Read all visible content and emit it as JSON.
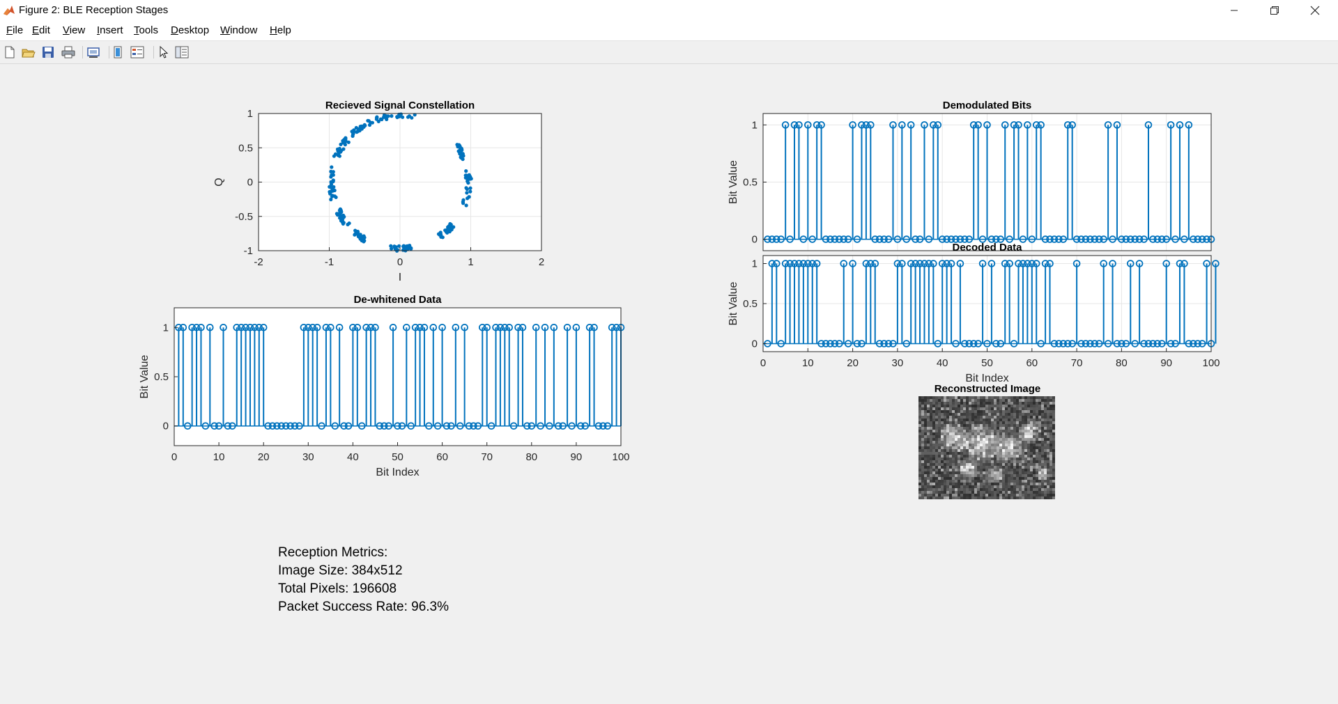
{
  "window": {
    "title": "Figure 2: BLE Reception Stages",
    "app_icon": "matlab-icon",
    "controls": [
      "minimize-icon",
      "maximize-icon",
      "close-icon"
    ]
  },
  "menu": {
    "file": {
      "label": "File",
      "underline": "F",
      "rest": "ile"
    },
    "edit": {
      "label": "Edit",
      "underline": "E",
      "rest": "dit"
    },
    "view": {
      "label": "View",
      "underline": "V",
      "rest": "iew"
    },
    "insert": {
      "label": "Insert",
      "underline": "I",
      "rest": "nsert"
    },
    "tools": {
      "label": "Tools",
      "underline": "T",
      "rest": "ools"
    },
    "desktop": {
      "label": "Desktop",
      "underline": "D",
      "rest": "esktop"
    },
    "window": {
      "label": "Window",
      "underline": "W",
      "rest": "indow"
    },
    "help": {
      "label": "Help",
      "underline": "H",
      "rest": "elp"
    }
  },
  "toolbar": {
    "icons": [
      "new-figure-icon",
      "open-file-icon",
      "save-icon",
      "print-icon",
      "print-preview-icon",
      "colorbar-icon",
      "legend-icon",
      "pointer-icon",
      "property-inspector-icon"
    ]
  },
  "colors": {
    "series": "#0072bd",
    "grid": "#e6e6e6",
    "axes": "#262626"
  },
  "chart_data": [
    {
      "id": "constellation",
      "type": "scatter",
      "title": "Recieved Signal Constellation",
      "xlabel": "I",
      "ylabel": "Q",
      "xlim": [
        -2,
        2
      ],
      "ylim": [
        -1,
        1
      ],
      "xticks": [
        -2,
        -1,
        0,
        1,
        2
      ],
      "yticks": [
        -1,
        -0.5,
        0,
        0.5,
        1
      ],
      "xticklabels": [
        "-2",
        "-1",
        "0",
        "1",
        "2"
      ],
      "yticklabels": [
        "-1",
        "-0.5",
        "0",
        "0.5",
        "1"
      ],
      "grid": true,
      "clusters": [
        {
          "angle_start": 78,
          "angle_end": 112
        },
        {
          "angle_start": 114,
          "angle_end": 135
        },
        {
          "angle_start": 140,
          "angle_end": 158
        },
        {
          "angle_start": 165,
          "angle_end": 195
        },
        {
          "angle_start": 205,
          "angle_end": 220
        },
        {
          "angle_start": 225,
          "angle_end": 240
        },
        {
          "angle_start": 262,
          "angle_end": 280
        },
        {
          "angle_start": 305,
          "angle_end": 320
        },
        {
          "angle_start": 340,
          "angle_end": 370
        },
        {
          "angle_start": 20,
          "angle_end": 35
        }
      ]
    },
    {
      "id": "demodulated",
      "type": "stem",
      "title": "Demodulated Bits",
      "xlabel": "",
      "ylabel": "Bit Value",
      "xlim": [
        0,
        100
      ],
      "ylim": [
        -0.1,
        1.1
      ],
      "xticks": [],
      "yticks": [
        0,
        0.5,
        1
      ],
      "yticklabels": [
        "0",
        "0.5",
        "1"
      ],
      "grid": true,
      "values": [
        0,
        0,
        0,
        0,
        1,
        0,
        1,
        1,
        0,
        1,
        0,
        1,
        1,
        0,
        0,
        0,
        0,
        0,
        0,
        1,
        0,
        1,
        1,
        1,
        0,
        0,
        0,
        0,
        1,
        0,
        1,
        0,
        1,
        0,
        0,
        1,
        0,
        1,
        1,
        0,
        0,
        0,
        0,
        0,
        0,
        0,
        1,
        1,
        0,
        1,
        0,
        0,
        0,
        1,
        0,
        1,
        1,
        0,
        1,
        0,
        1,
        1,
        0,
        0,
        0,
        0,
        0,
        1,
        1,
        0,
        0,
        0,
        0,
        0,
        0,
        0,
        1,
        0,
        1,
        0,
        0,
        0,
        0,
        0,
        0,
        1,
        0,
        0,
        0,
        0,
        1,
        0,
        1,
        0,
        1,
        0,
        0,
        0,
        0,
        0
      ]
    },
    {
      "id": "decoded",
      "type": "stem",
      "title": "Decoded Data",
      "xlabel": "Bit Index",
      "ylabel": "Bit Value",
      "xlim": [
        0,
        100
      ],
      "ylim": [
        -0.1,
        1.1
      ],
      "xticks": [
        0,
        10,
        20,
        30,
        40,
        50,
        60,
        70,
        80,
        90,
        100
      ],
      "xticklabels": [
        "0",
        "10",
        "20",
        "30",
        "40",
        "50",
        "60",
        "70",
        "80",
        "90",
        "100"
      ],
      "yticks": [
        0,
        0.5,
        1
      ],
      "yticklabels": [
        "0",
        "0.5",
        "1"
      ],
      "grid": true,
      "values": [
        0,
        1,
        1,
        0,
        1,
        1,
        1,
        1,
        1,
        1,
        1,
        1,
        0,
        0,
        0,
        0,
        0,
        1,
        0,
        1,
        0,
        0,
        1,
        1,
        1,
        0,
        0,
        0,
        0,
        1,
        1,
        0,
        1,
        1,
        1,
        1,
        1,
        1,
        0,
        1,
        1,
        1,
        0,
        1,
        0,
        0,
        0,
        0,
        1,
        0,
        1,
        0,
        0,
        1,
        1,
        0,
        1,
        1,
        1,
        1,
        1,
        0,
        1,
        1,
        0,
        0,
        0,
        0,
        0,
        1,
        0,
        0,
        0,
        0,
        0,
        1,
        0,
        1,
        0,
        0,
        0,
        1,
        0,
        1,
        0,
        0,
        0,
        0,
        0,
        1,
        0,
        0,
        1,
        1,
        0,
        0,
        0,
        0,
        1,
        0,
        1
      ]
    },
    {
      "id": "dewhitened",
      "type": "stem",
      "title": "De-whitened Data",
      "xlabel": "Bit Index",
      "ylabel": "Bit Value",
      "xlim": [
        0,
        100
      ],
      "ylim": [
        -0.2,
        1.2
      ],
      "xticks": [
        0,
        10,
        20,
        30,
        40,
        50,
        60,
        70,
        80,
        90,
        100
      ],
      "xticklabels": [
        "0",
        "10",
        "20",
        "30",
        "40",
        "50",
        "60",
        "70",
        "80",
        "90",
        "100"
      ],
      "yticks": [
        0,
        0.5,
        1
      ],
      "yticklabels": [
        "0",
        "0.5",
        "1"
      ],
      "grid": false,
      "values": [
        1,
        1,
        0,
        1,
        1,
        1,
        0,
        1,
        0,
        0,
        1,
        0,
        0,
        1,
        1,
        1,
        1,
        1,
        1,
        1,
        0,
        0,
        0,
        0,
        0,
        0,
        0,
        0,
        1,
        1,
        1,
        1,
        0,
        1,
        1,
        0,
        1,
        0,
        0,
        1,
        1,
        0,
        1,
        1,
        1,
        0,
        0,
        0,
        1,
        0,
        0,
        1,
        0,
        1,
        1,
        1,
        0,
        1,
        0,
        1,
        0,
        0,
        1,
        0,
        1,
        0,
        0,
        0,
        1,
        1,
        0,
        1,
        1,
        1,
        1,
        0,
        1,
        1,
        0,
        0,
        1,
        0,
        1,
        0,
        1,
        0,
        0,
        1,
        0,
        1,
        0,
        0,
        1,
        1,
        0,
        0,
        0,
        1,
        1,
        1
      ]
    }
  ],
  "image_panel": {
    "title": "Reconstructed Image"
  },
  "metrics": {
    "heading": "Reception Metrics:",
    "image_size": "Image Size: 384x512",
    "total_pixels": "Total Pixels: 196608",
    "packet_success": "Packet Success Rate: 96.3%"
  }
}
